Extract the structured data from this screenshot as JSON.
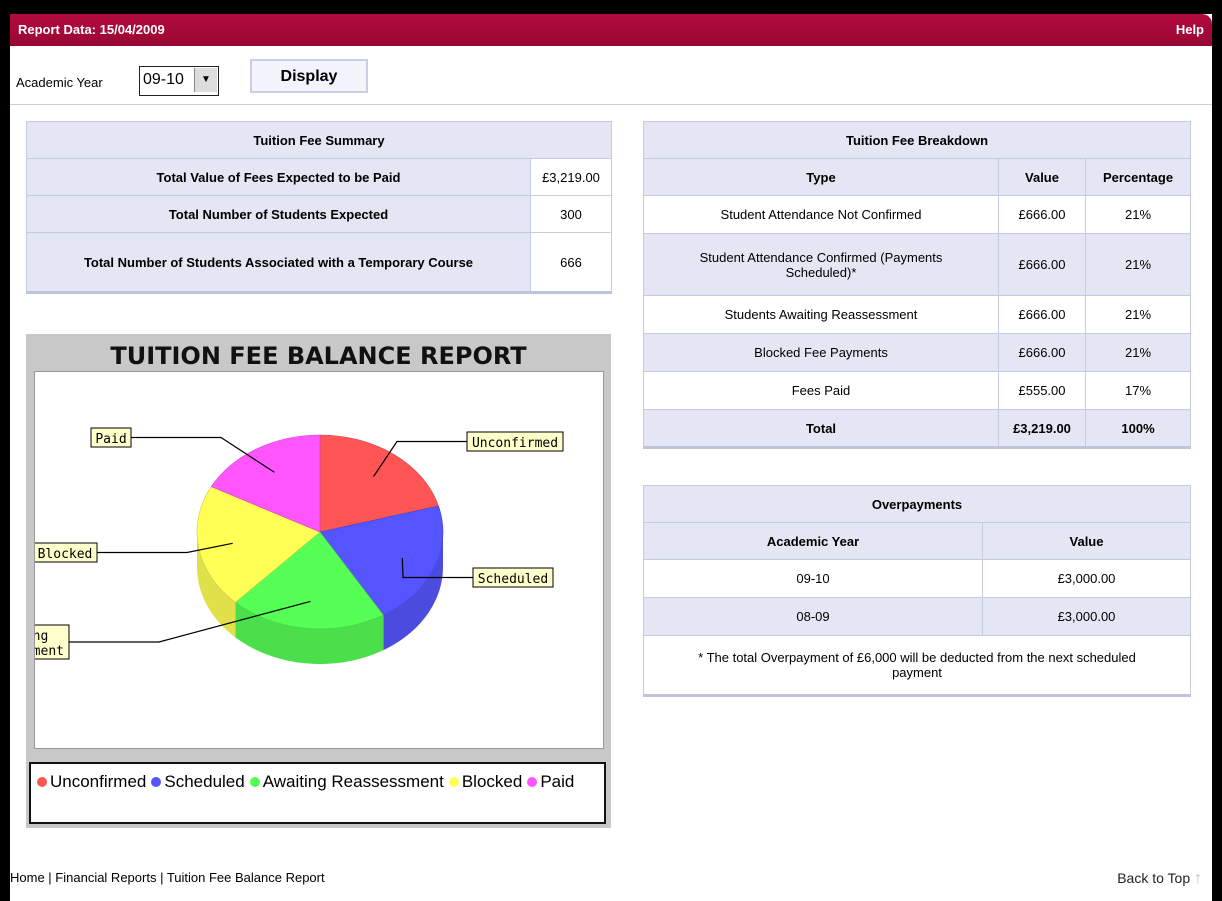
{
  "header": {
    "report_date": "Report Data: 15/04/2009",
    "help": "Help"
  },
  "toolbar": {
    "academic_year_label": "Academic Year",
    "academic_year_value": "09-10",
    "display_button": "Display"
  },
  "summary": {
    "title": "Tuition Fee Summary",
    "rows": [
      {
        "label": "Total Value of Fees Expected to be Paid",
        "value": "£3,219.00"
      },
      {
        "label": "Total Number of Students Expected",
        "value": "300"
      },
      {
        "label": "Total Number of Students Associated with a Temporary Course",
        "value": "666"
      }
    ]
  },
  "breakdown": {
    "title": "Tuition Fee Breakdown",
    "headers": [
      "Type",
      "Value",
      "Percentage"
    ],
    "rows": [
      {
        "type": "Student Attendance Not Confirmed",
        "value": "£666.00",
        "pct": "21%"
      },
      {
        "type": "Student Attendance Confirmed (Payments Scheduled)*",
        "value": "£666.00",
        "pct": "21%"
      },
      {
        "type": "Students Awaiting Reassessment",
        "value": "£666.00",
        "pct": "21%"
      },
      {
        "type": "Blocked Fee Payments",
        "value": "£666.00",
        "pct": "21%"
      },
      {
        "type": "Fees Paid",
        "value": "£555.00",
        "pct": "17%"
      }
    ],
    "total": {
      "type": "Total",
      "value": "£3,219.00",
      "pct": "100%"
    }
  },
  "overpayments": {
    "title": "Overpayments",
    "headers": [
      "Academic Year",
      "Value"
    ],
    "rows": [
      {
        "year": "09-10",
        "value": "£3,000.00"
      },
      {
        "year": "08-09",
        "value": "£3,000.00"
      }
    ],
    "note": "* The total Overpayment of £6,000 will be deducted from the next scheduled payment"
  },
  "chart_data": {
    "type": "pie",
    "title": "TUITION FEE BALANCE REPORT",
    "labels": [
      "Unconfirmed",
      "Scheduled",
      "Awaiting Reassessment",
      "Blocked",
      "Paid"
    ],
    "values": [
      666,
      666,
      666,
      666,
      555
    ],
    "colors": [
      "#ff5555",
      "#5555ff",
      "#55ff55",
      "#ffff55",
      "#ff55ff"
    ],
    "legend_position": "bottom"
  },
  "footer": {
    "home": "Home",
    "financial_reports": "Financial Reports",
    "current": "Tuition Fee Balance Report",
    "separator": " | ",
    "back_to_top": "Back to Top",
    "up_arrow_icon": "↑"
  }
}
